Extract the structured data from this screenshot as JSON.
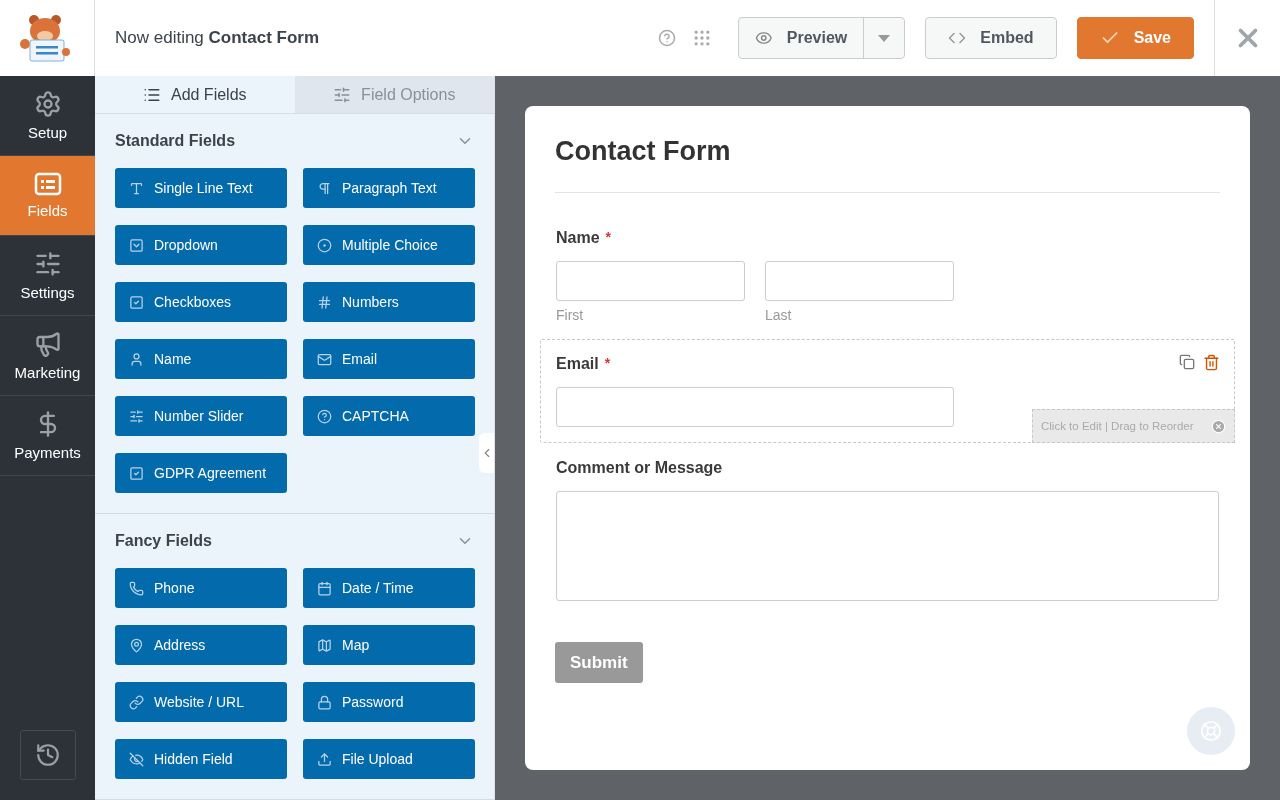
{
  "header": {
    "prefix": "Now editing",
    "title": "Contact Form",
    "preview": "Preview",
    "embed": "Embed",
    "save": "Save"
  },
  "nav": [
    {
      "kind": "setup",
      "label": "Setup",
      "selected": false
    },
    {
      "kind": "fields",
      "label": "Fields",
      "selected": true
    },
    {
      "kind": "settings",
      "label": "Settings",
      "selected": false
    },
    {
      "kind": "marketing",
      "label": "Marketing",
      "selected": false
    },
    {
      "kind": "payments",
      "label": "Payments",
      "selected": false
    }
  ],
  "tabs": [
    {
      "kind": "add",
      "label": "Add Fields",
      "selected": true
    },
    {
      "kind": "options",
      "label": "Field Options",
      "selected": false
    }
  ],
  "sections": [
    {
      "title": "Standard Fields",
      "expanded": true,
      "fields": [
        {
          "kind": "text",
          "label": "Single Line Text"
        },
        {
          "kind": "paragraph",
          "label": "Paragraph Text"
        },
        {
          "kind": "dropdown",
          "label": "Dropdown"
        },
        {
          "kind": "radio",
          "label": "Multiple Choice"
        },
        {
          "kind": "checkbox",
          "label": "Checkboxes"
        },
        {
          "kind": "number",
          "label": "Numbers"
        },
        {
          "kind": "name",
          "label": "Name"
        },
        {
          "kind": "email",
          "label": "Email"
        },
        {
          "kind": "slider",
          "label": "Number Slider"
        },
        {
          "kind": "captcha",
          "label": "CAPTCHA"
        },
        {
          "kind": "checkbox",
          "label": "GDPR Agreement"
        }
      ]
    },
    {
      "title": "Fancy Fields",
      "expanded": true,
      "fields": [
        {
          "kind": "phone",
          "label": "Phone"
        },
        {
          "kind": "date",
          "label": "Date / Time"
        },
        {
          "kind": "address",
          "label": "Address"
        },
        {
          "kind": "map",
          "label": "Map"
        },
        {
          "kind": "url",
          "label": "Website / URL"
        },
        {
          "kind": "password",
          "label": "Password"
        },
        {
          "kind": "hidden",
          "label": "Hidden Field"
        },
        {
          "kind": "upload",
          "label": "File Upload"
        }
      ]
    }
  ],
  "form": {
    "title": "Contact Form",
    "fields": [
      {
        "kind": "name",
        "label": "Name",
        "required_mark": "*",
        "selected": false,
        "sublabels": [
          "First",
          "Last"
        ]
      },
      {
        "kind": "email",
        "label": "Email",
        "required_mark": "*",
        "selected": true,
        "hint": "Click to Edit | Drag to Reorder"
      },
      {
        "kind": "textarea",
        "label": "Comment or Message",
        "selected": false
      }
    ],
    "submit": "Submit"
  }
}
